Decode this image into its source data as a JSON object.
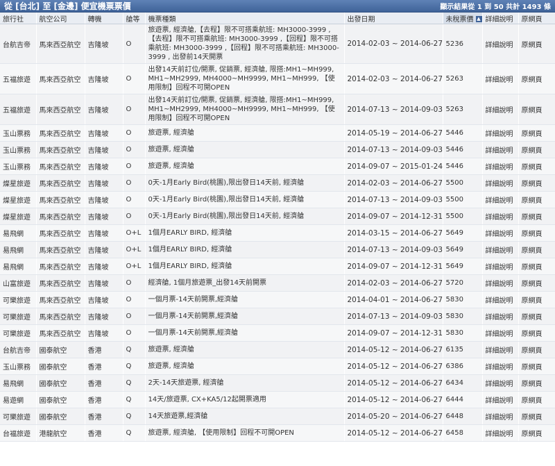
{
  "header": {
    "title": "從 [台北] 至 [金邊] 便宜機票票價",
    "result_info": "顯示結果從 1 到 50 共計 1493 條"
  },
  "columns": {
    "agency": "旅行社",
    "airline": "航空公司",
    "transit": "轉機",
    "cabin": "艙等",
    "ticket_type": "機票種類",
    "departure": "出發日期",
    "price": "未稅票價",
    "details": "詳細說明",
    "source": "原網頁"
  },
  "sort_icon": "sort-up-icon",
  "rows": [
    {
      "agency": "台航吉帝",
      "airline": "馬來西亞航空",
      "transit": "吉隆坡",
      "cabin": "O",
      "ticket_type": "旅遊票, 經濟艙,【去程】限不可搭乘航班: MH3000-3999 ,【去程】限不可搭乘航班: MH3000-3999 ,【回程】限不可搭乘航班: MH3000-3999 ,【回程】限不可搭乘航班: MH3000-3999 , 出發前14天開票",
      "departure": "2014-02-03 ~ 2014-06-27",
      "price": "5236",
      "details": "詳細說明",
      "source": "原網頁"
    },
    {
      "agency": "五福旅遊",
      "airline": "馬來西亞航空",
      "transit": "吉隆坡",
      "cabin": "O",
      "ticket_type": "出發14天前訂位/開票, 促銷票, 經濟艙, 限搭:MH1~MH999, MH1~MH2999, MH4000~MH9999, MH1~MH999, 【使用限制】回程不可開OPEN",
      "departure": "2014-02-03 ~ 2014-06-27",
      "price": "5263",
      "details": "詳細說明",
      "source": "原網頁"
    },
    {
      "agency": "五福旅遊",
      "airline": "馬來西亞航空",
      "transit": "吉隆坡",
      "cabin": "O",
      "ticket_type": "出發14天前訂位/開票, 促銷票, 經濟艙, 限搭:MH1~MH999, MH1~MH2999, MH4000~MH9999, MH1~MH999, 【使用限制】回程不可開OPEN",
      "departure": "2014-07-13 ~ 2014-09-03",
      "price": "5263",
      "details": "詳細說明",
      "source": "原網頁"
    },
    {
      "agency": "玉山票務",
      "airline": "馬來西亞航空",
      "transit": "吉隆坡",
      "cabin": "O",
      "ticket_type": "旅遊票, 經濟艙",
      "departure": "2014-05-19 ~ 2014-06-27",
      "price": "5446",
      "details": "詳細說明",
      "source": "原網頁"
    },
    {
      "agency": "玉山票務",
      "airline": "馬來西亞航空",
      "transit": "吉隆坡",
      "cabin": "O",
      "ticket_type": "旅遊票, 經濟艙",
      "departure": "2014-07-13 ~ 2014-09-03",
      "price": "5446",
      "details": "詳細說明",
      "source": "原網頁"
    },
    {
      "agency": "玉山票務",
      "airline": "馬來西亞航空",
      "transit": "吉隆坡",
      "cabin": "O",
      "ticket_type": "旅遊票, 經濟艙",
      "departure": "2014-09-07 ~ 2015-01-24",
      "price": "5446",
      "details": "詳細說明",
      "source": "原網頁"
    },
    {
      "agency": "燦星旅遊",
      "airline": "馬來西亞航空",
      "transit": "吉隆坡",
      "cabin": "O",
      "ticket_type": "0天-1月Early Bird(桃園),限出發日14天前, 經濟艙",
      "departure": "2014-02-03 ~ 2014-06-27",
      "price": "5500",
      "details": "詳細說明",
      "source": "原網頁"
    },
    {
      "agency": "燦星旅遊",
      "airline": "馬來西亞航空",
      "transit": "吉隆坡",
      "cabin": "O",
      "ticket_type": "0天-1月Early Bird(桃園),限出發日14天前, 經濟艙",
      "departure": "2014-07-13 ~ 2014-09-03",
      "price": "5500",
      "details": "詳細說明",
      "source": "原網頁"
    },
    {
      "agency": "燦星旅遊",
      "airline": "馬來西亞航空",
      "transit": "吉隆坡",
      "cabin": "O",
      "ticket_type": "0天-1月Early Bird(桃園),限出發日14天前, 經濟艙",
      "departure": "2014-09-07 ~ 2014-12-31",
      "price": "5500",
      "details": "詳細說明",
      "source": "原網頁"
    },
    {
      "agency": "易飛網",
      "airline": "馬來西亞航空",
      "transit": "吉隆坡",
      "cabin": "O+L",
      "ticket_type": "1個月EARLY BIRD, 經濟艙",
      "departure": "2014-03-15 ~ 2014-06-27",
      "price": "5649",
      "details": "詳細說明",
      "source": "原網頁"
    },
    {
      "agency": "易飛網",
      "airline": "馬來西亞航空",
      "transit": "吉隆坡",
      "cabin": "O+L",
      "ticket_type": "1個月EARLY BIRD, 經濟艙",
      "departure": "2014-07-13 ~ 2014-09-03",
      "price": "5649",
      "details": "詳細說明",
      "source": "原網頁"
    },
    {
      "agency": "易飛網",
      "airline": "馬來西亞航空",
      "transit": "吉隆坡",
      "cabin": "O+L",
      "ticket_type": "1個月EARLY BIRD, 經濟艙",
      "departure": "2014-09-07 ~ 2014-12-31",
      "price": "5649",
      "details": "詳細說明",
      "source": "原網頁"
    },
    {
      "agency": "山富旅遊",
      "airline": "馬來西亞航空",
      "transit": "吉隆坡",
      "cabin": "O",
      "ticket_type": "經濟艙, 1個月旅遊票_出發14天前開票",
      "departure": "2014-02-03 ~ 2014-06-27",
      "price": "5720",
      "details": "詳細說明",
      "source": "原網頁"
    },
    {
      "agency": "可樂旅遊",
      "airline": "馬來西亞航空",
      "transit": "吉隆坡",
      "cabin": "O",
      "ticket_type": "一個月票-14天前開票,經濟艙",
      "departure": "2014-04-01 ~ 2014-06-27",
      "price": "5830",
      "details": "詳細說明",
      "source": "原網頁"
    },
    {
      "agency": "可樂旅遊",
      "airline": "馬來西亞航空",
      "transit": "吉隆坡",
      "cabin": "O",
      "ticket_type": "一個月票-14天前開票,經濟艙",
      "departure": "2014-07-13 ~ 2014-09-03",
      "price": "5830",
      "details": "詳細說明",
      "source": "原網頁"
    },
    {
      "agency": "可樂旅遊",
      "airline": "馬來西亞航空",
      "transit": "吉隆坡",
      "cabin": "O",
      "ticket_type": "一個月票-14天前開票,經濟艙",
      "departure": "2014-09-07 ~ 2014-12-31",
      "price": "5830",
      "details": "詳細說明",
      "source": "原網頁"
    },
    {
      "agency": "台航吉帝",
      "airline": "國泰航空",
      "transit": "香港",
      "cabin": "Q",
      "ticket_type": "旅遊票, 經濟艙",
      "departure": "2014-05-12 ~ 2014-06-27",
      "price": "6135",
      "details": "詳細說明",
      "source": "原網頁"
    },
    {
      "agency": "玉山票務",
      "airline": "國泰航空",
      "transit": "香港",
      "cabin": "Q",
      "ticket_type": "旅遊票, 經濟艙",
      "departure": "2014-05-12 ~ 2014-06-27",
      "price": "6386",
      "details": "詳細說明",
      "source": "原網頁"
    },
    {
      "agency": "易飛網",
      "airline": "國泰航空",
      "transit": "香港",
      "cabin": "Q",
      "ticket_type": "2天-14天旅遊票, 經濟艙",
      "departure": "2014-05-12 ~ 2014-06-27",
      "price": "6434",
      "details": "詳細說明",
      "source": "原網頁"
    },
    {
      "agency": "易遊網",
      "airline": "國泰航空",
      "transit": "香港",
      "cabin": "Q",
      "ticket_type": "14天/旅遊票, CX+KA5/12起開票適用",
      "departure": "2014-05-12 ~ 2014-06-27",
      "price": "6444",
      "details": "詳細說明",
      "source": "原網頁"
    },
    {
      "agency": "可樂旅遊",
      "airline": "國泰航空",
      "transit": "香港",
      "cabin": "Q",
      "ticket_type": "14天旅遊票,經濟艙",
      "departure": "2014-05-20 ~ 2014-06-27",
      "price": "6448",
      "details": "詳細說明",
      "source": "原網頁"
    },
    {
      "agency": "台福旅遊",
      "airline": "港龍航空",
      "transit": "香港",
      "cabin": "Q",
      "ticket_type": "旅遊票, 經濟艙, 【使用限制】回程不可開OPEN",
      "departure": "2014-05-12 ~ 2014-06-27",
      "price": "6458",
      "details": "詳細說明",
      "source": "原網頁"
    }
  ]
}
